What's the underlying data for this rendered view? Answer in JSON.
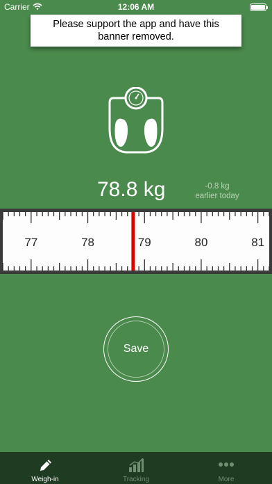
{
  "status_bar": {
    "carrier": "Carrier",
    "time": "12:06 AM"
  },
  "banner": {
    "text": "Please support the app and have this banner removed."
  },
  "weighin": {
    "weight": "78.8 kg",
    "change": "-0.8 kg",
    "change_when": "earlier today"
  },
  "ruler": {
    "labels": [
      "77",
      "78",
      "79",
      "80",
      "81"
    ],
    "min": 76.5,
    "max": 81.2,
    "current": 78.8
  },
  "save": {
    "label": "Save"
  },
  "tabs": [
    {
      "label": "Weigh-in",
      "icon": "pencil-icon",
      "active": true
    },
    {
      "label": "Tracking",
      "icon": "bar-chart-icon",
      "active": false
    },
    {
      "label": "More",
      "icon": "more-dots-icon",
      "active": false
    }
  ],
  "colors": {
    "background": "#4a8a4c",
    "tab_bar": "#1f3b22",
    "indicator": "#e00000",
    "muted_text": "#b9d3b9",
    "inactive_tab": "#6f8f70"
  }
}
